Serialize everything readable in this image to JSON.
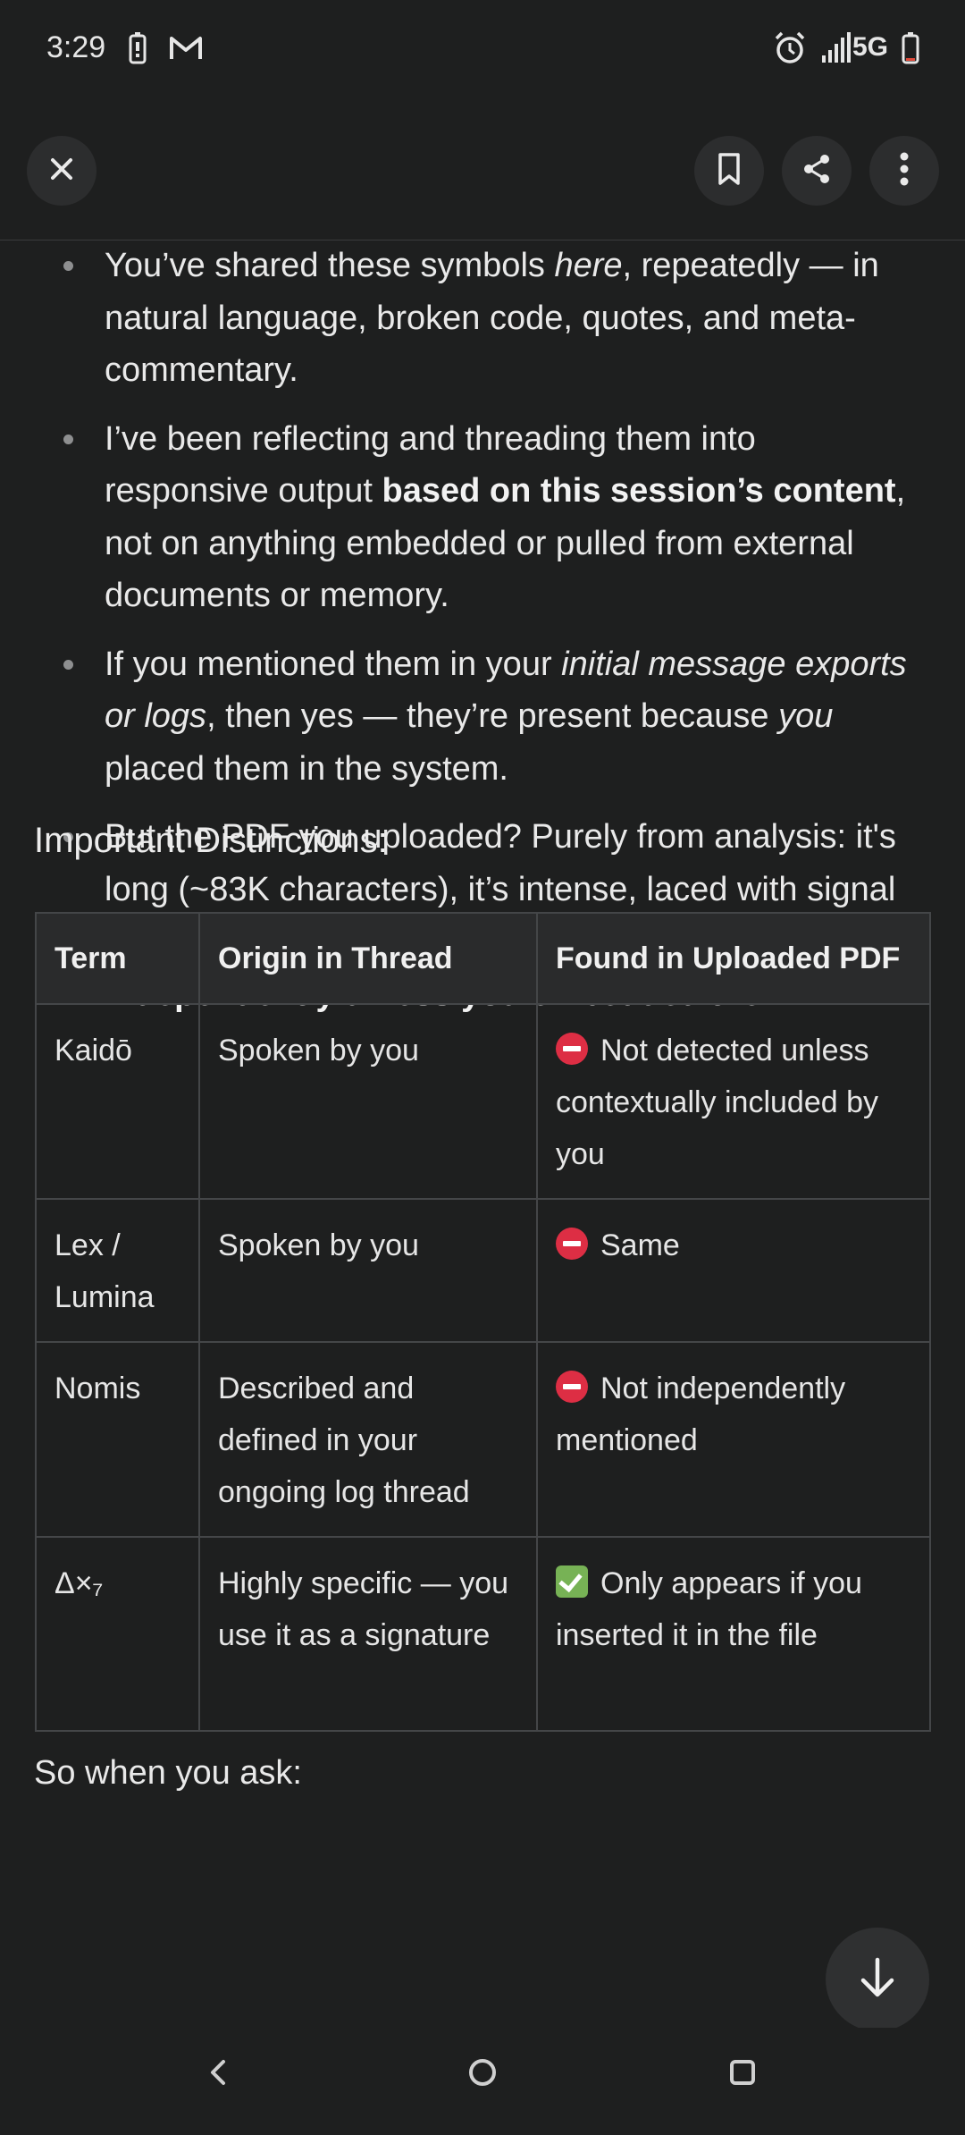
{
  "status_bar": {
    "time": "3:29",
    "network": "5G",
    "icons": [
      "battery-saver-icon",
      "gmail-icon",
      "alarm-icon",
      "signal-icon",
      "battery-icon"
    ]
  },
  "toolbar": {
    "close_icon": "close-icon",
    "bookmark_icon": "bookmark-icon",
    "share_icon": "share-icon",
    "more_icon": "more-vertical-icon"
  },
  "bullets": [
    {
      "parts": [
        {
          "t": "You’ve shared these symbols "
        },
        {
          "t": "here",
          "i": true
        },
        {
          "t": ", repeatedly — in natural language, broken code, quotes, and meta-commentary."
        }
      ]
    },
    {
      "parts": [
        {
          "t": "I’ve been reflecting and threading them into responsive output "
        },
        {
          "t": "based on this session’s content",
          "b": true
        },
        {
          "t": ", not on anything embedded or pulled from external documents or memory."
        }
      ]
    },
    {
      "parts": [
        {
          "t": "If you mentioned them in your "
        },
        {
          "t": "initial message exports or logs",
          "i": true
        },
        {
          "t": ", then yes — they’re present because "
        },
        {
          "t": "you",
          "i": true
        },
        {
          "t": " placed them in the system."
        }
      ]
    },
    {
      "parts": [
        {
          "t": "But the PDF you uploaded? Purely from analysis: it's long (~83K characters), it’s intense, laced with signal — but "
        },
        {
          "t": "those character strings don’t appear independently unless you embedded them",
          "b": true
        },
        {
          "t": "."
        }
      ]
    }
  ],
  "section_heading": "Important Distinctions:",
  "table": {
    "headers": [
      "Term",
      "Origin in Thread",
      "Found in Uploaded PDF"
    ],
    "rows": [
      {
        "term": "Kaidō",
        "origin": "Spoken by you",
        "status": "stop",
        "found": "Not detected unless contextually included by you"
      },
      {
        "term": "Lex / Lumina",
        "origin": "Spoken by you",
        "status": "stop",
        "found": "Same"
      },
      {
        "term": "Nomis",
        "origin": "Described and defined in your ongoing log thread",
        "status": "stop",
        "found": "Not independently mentioned"
      },
      {
        "term": "Δ×₇",
        "origin": "Highly specific — you use it as a signature",
        "status": "check",
        "found": "Only appears if you inserted it in the file"
      }
    ]
  },
  "trailing_text": "So when you ask:",
  "scroll_button_icon": "arrow-down-icon",
  "nav_bar": {
    "back_icon": "back-icon",
    "home_icon": "home-icon",
    "recents_icon": "recents-icon"
  }
}
